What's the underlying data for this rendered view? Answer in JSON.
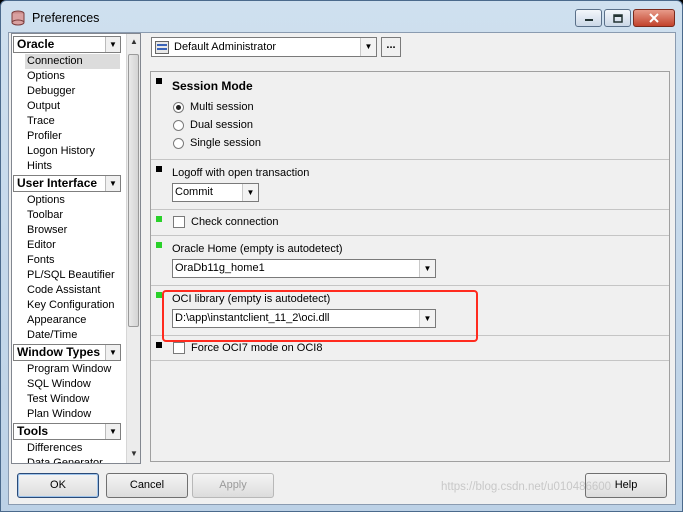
{
  "window": {
    "title": "Preferences",
    "caption_buttons": {
      "minimize": "minimize",
      "maximize": "maximize",
      "close": "close"
    }
  },
  "sidebar": {
    "categories": [
      {
        "label": "Oracle",
        "items": [
          "Connection",
          "Options",
          "Debugger",
          "Output",
          "Trace",
          "Profiler",
          "Logon History",
          "Hints"
        ]
      },
      {
        "label": "User Interface",
        "items": [
          "Options",
          "Toolbar",
          "Browser",
          "Editor",
          "Fonts",
          "PL/SQL Beautifier",
          "Code Assistant",
          "Key Configuration",
          "Appearance",
          "Date/Time"
        ]
      },
      {
        "label": "Window Types",
        "items": [
          "Program Window",
          "SQL Window",
          "Test Window",
          "Plan Window"
        ]
      },
      {
        "label": "Tools",
        "items": [
          "Differences",
          "Data Generator"
        ]
      }
    ],
    "selected": "Connection"
  },
  "profile": {
    "value": "Default Administrator",
    "more_label": "..."
  },
  "sections": {
    "session_mode": {
      "title": "Session Mode",
      "options": [
        "Multi session",
        "Dual session",
        "Single session"
      ],
      "selected": "Multi session"
    },
    "logoff": {
      "label": "Logoff with open transaction",
      "value": "Commit"
    },
    "check_connection": {
      "label": "Check connection",
      "checked": false
    },
    "oracle_home": {
      "label": "Oracle Home (empty is autodetect)",
      "value": "OraDb11g_home1"
    },
    "oci_library": {
      "label": "OCI library (empty is autodetect)",
      "value": "D:\\app\\instantclient_11_2\\oci.dll"
    },
    "force_oci7": {
      "label": "Force OCI7 mode on OCI8",
      "checked": false
    }
  },
  "buttons": {
    "ok": "OK",
    "cancel": "Cancel",
    "apply": "Apply",
    "help": "Help"
  },
  "watermark": "https://blog.csdn.net/u010486600",
  "colors": {
    "highlight_border": "#ff2b1f",
    "marker_green": "#2ad12a",
    "title_gradient": "#cfe0ef"
  }
}
